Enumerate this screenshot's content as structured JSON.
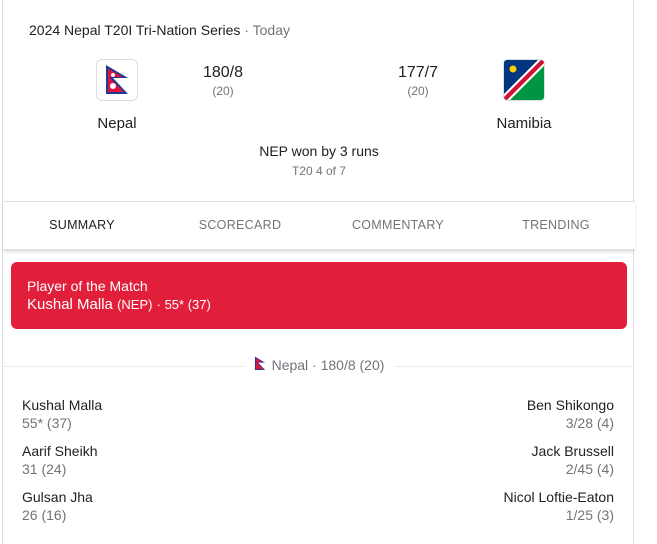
{
  "header": {
    "series": "2024 Nepal T20I Tri-Nation Series",
    "separator": "·",
    "when": "Today"
  },
  "teams": {
    "home": {
      "name": "Nepal",
      "runs": "180/8",
      "overs": "(20)",
      "flag_icon": "nepal-flag-icon"
    },
    "away": {
      "name": "Namibia",
      "runs": "177/7",
      "overs": "(20)",
      "flag_icon": "namibia-flag-icon"
    }
  },
  "result": "NEP won by 3 runs",
  "match_number": "T20 4 of 7",
  "tabs": [
    {
      "label": "SUMMARY",
      "active": true
    },
    {
      "label": "SCORECARD",
      "active": false
    },
    {
      "label": "COMMENTARY",
      "active": false
    },
    {
      "label": "TRENDING",
      "active": false
    }
  ],
  "player_of_match": {
    "title": "Player of the Match",
    "name": "Kushal Malla",
    "team": "(NEP)",
    "stat": "· 55* (37)",
    "color": "#e21f3a"
  },
  "innings": {
    "label": "Nepal · 180/8 (20)",
    "batters": [
      {
        "name": "Kushal Malla",
        "stat": "55* (37)"
      },
      {
        "name": "Aarif Sheikh",
        "stat": "31 (24)"
      },
      {
        "name": "Gulsan Jha",
        "stat": "26 (16)"
      }
    ],
    "bowlers": [
      {
        "name": "Ben Shikongo",
        "stat": "3/28 (4)"
      },
      {
        "name": "Jack Brussell",
        "stat": "2/45 (4)"
      },
      {
        "name": "Nicol Loftie-Eaton",
        "stat": "1/25 (3)"
      }
    ]
  }
}
